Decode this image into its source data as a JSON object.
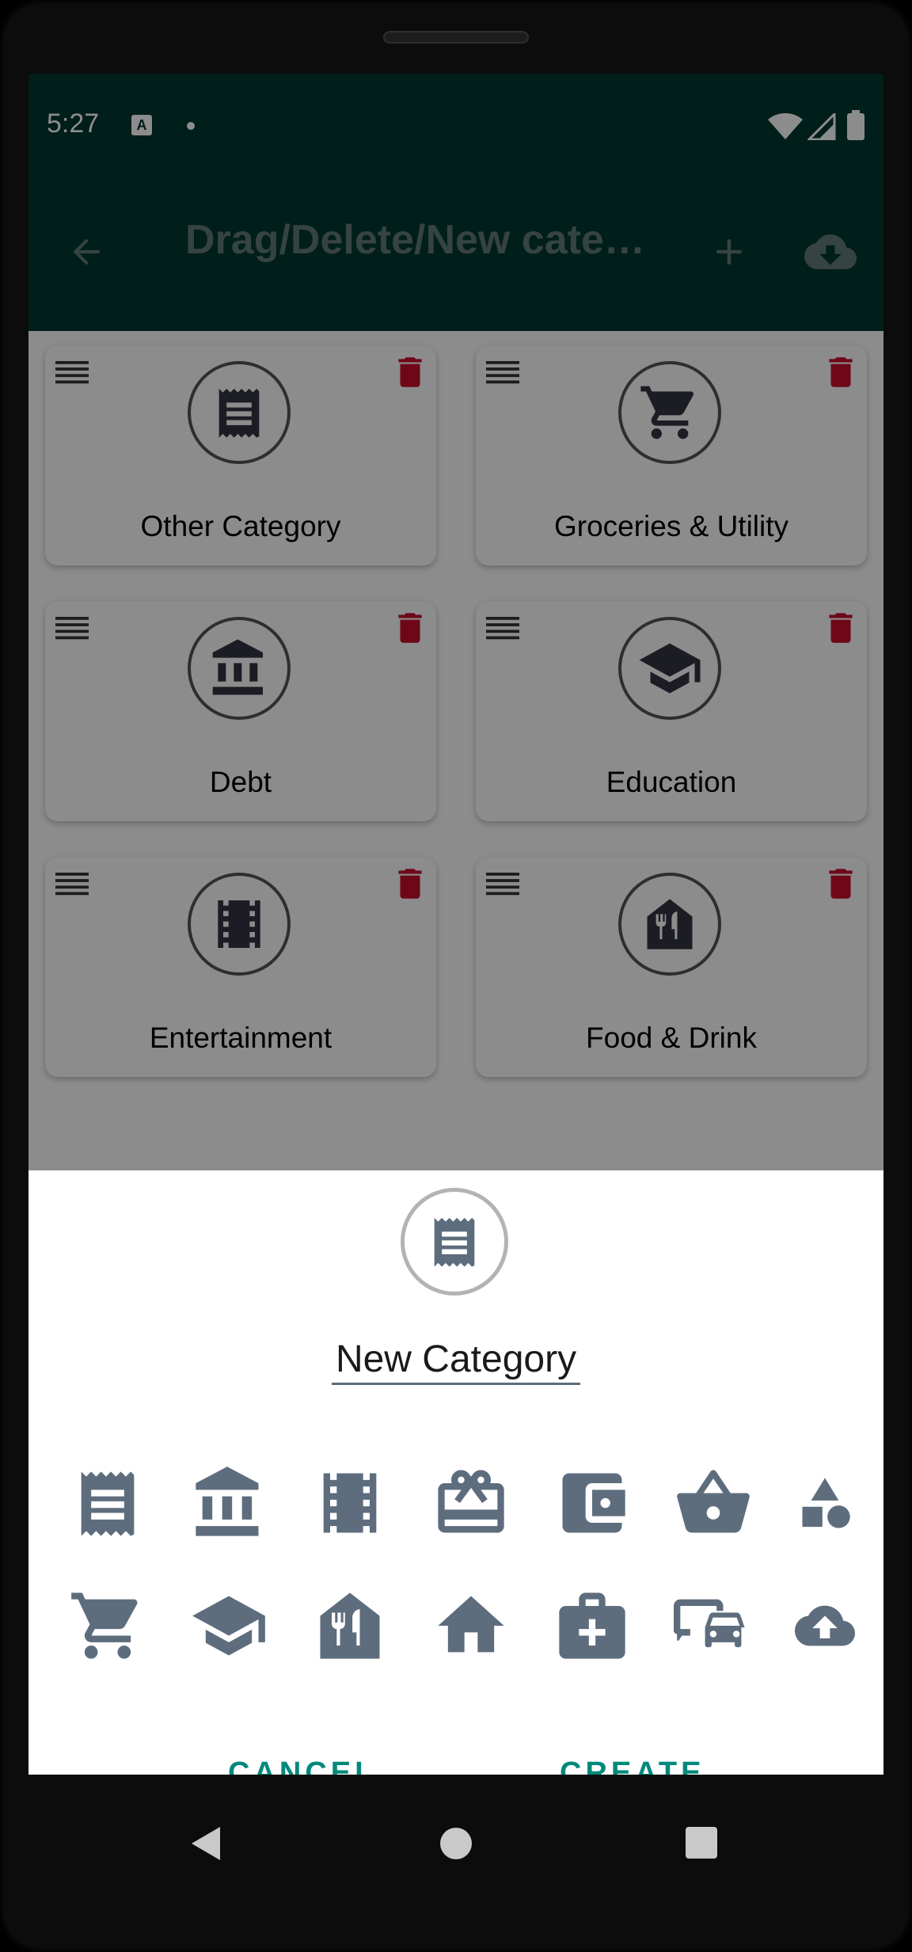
{
  "status": {
    "time": "5:27"
  },
  "appbar": {
    "title": "Drag/Delete/New cate…"
  },
  "categories": [
    {
      "label": "Other Category",
      "icon": "receipt-icon"
    },
    {
      "label": "Groceries & Utility",
      "icon": "cart-icon"
    },
    {
      "label": "Debt",
      "icon": "bank-icon"
    },
    {
      "label": "Education",
      "icon": "graduation-cap-icon"
    },
    {
      "label": "Entertainment",
      "icon": "film-icon"
    },
    {
      "label": "Food & Drink",
      "icon": "restaurant-icon"
    }
  ],
  "sheet": {
    "name_value": "New Category",
    "cancel_label": "CANCEL",
    "create_label": "CREATE",
    "icon_choices": [
      "receipt-icon",
      "bank-icon",
      "film-icon",
      "gift-card-icon",
      "wallet-icon",
      "basket-icon",
      "shapes-icon",
      "cart-icon",
      "graduation-cap-icon",
      "restaurant-icon",
      "home-icon",
      "medical-bag-icon",
      "car-transport-icon",
      "cloud-upload-icon"
    ]
  },
  "colors": {
    "appbar": "#013731",
    "accent": "#00897b",
    "icon": "#5e6d7d",
    "trash": "#8b0e1a"
  }
}
